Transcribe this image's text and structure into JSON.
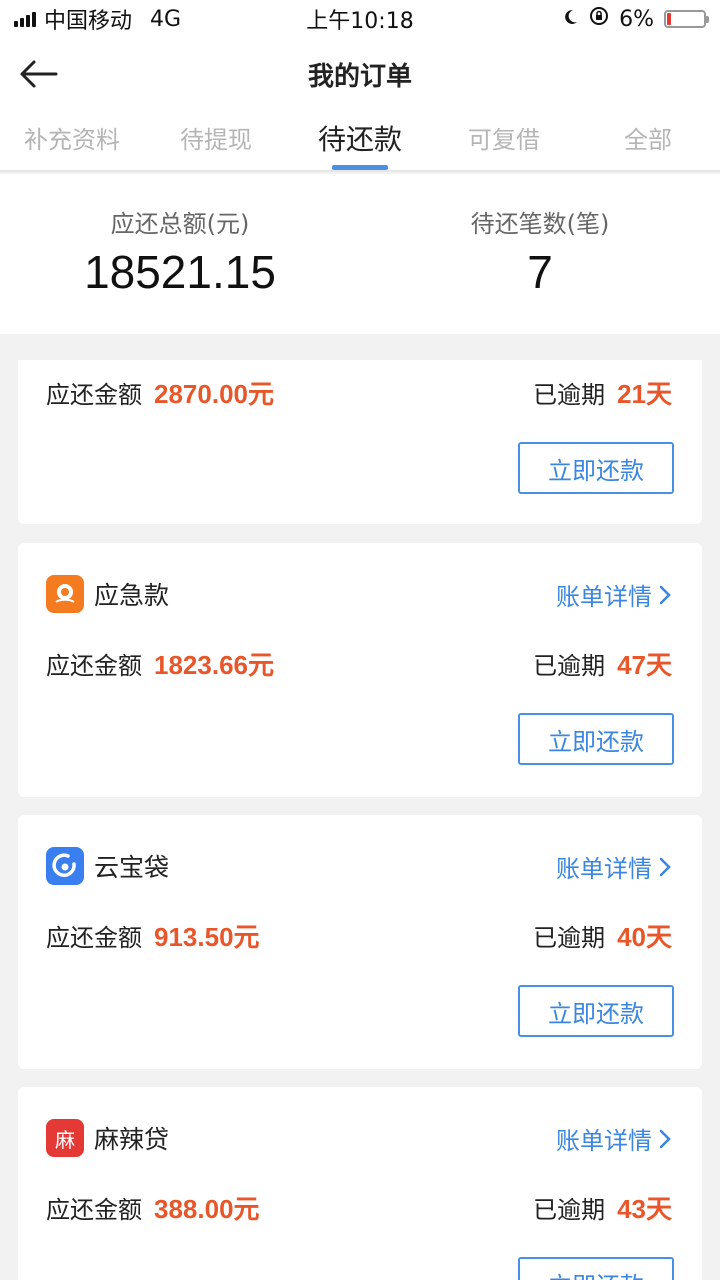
{
  "status_bar": {
    "carrier": "中国移动",
    "network": "4G",
    "time": "上午10:18",
    "battery": "6%",
    "battery_level": 0.06
  },
  "nav": {
    "title": "我的订单"
  },
  "tabs": [
    {
      "label": "补充资料"
    },
    {
      "label": "待提现"
    },
    {
      "label": "待还款"
    },
    {
      "label": "可复借"
    },
    {
      "label": "全部"
    }
  ],
  "active_tab": "待还款",
  "summary": {
    "total_label": "应还总额(元)",
    "total_value": "18521.15",
    "count_label": "待还笔数(笔)",
    "count_value": "7"
  },
  "labels": {
    "amount": "应还金额",
    "overdue": "已逾期",
    "detail": "账单详情",
    "repay": "立即还款"
  },
  "orders": [
    {
      "name": "",
      "amount": "2870.00元",
      "overdue": "21天",
      "icon": "unknown-icon"
    },
    {
      "name": "应急款",
      "amount": "1823.66元",
      "overdue": "47天",
      "icon": "emergency-loan-icon",
      "icon_color": "#f47b20"
    },
    {
      "name": "云宝袋",
      "amount": "913.50元",
      "overdue": "40天",
      "icon": "yunbaodai-icon",
      "icon_color": "#3a7ff0"
    },
    {
      "name": "麻辣贷",
      "amount": "388.00元",
      "overdue": "43天",
      "icon": "malaidai-icon",
      "icon_color": "#e53935",
      "icon_char": "麻"
    }
  ],
  "colors": {
    "accent": "#3a86e0",
    "amount": "#e8562a",
    "tab_indicator": "#4a90e2"
  }
}
